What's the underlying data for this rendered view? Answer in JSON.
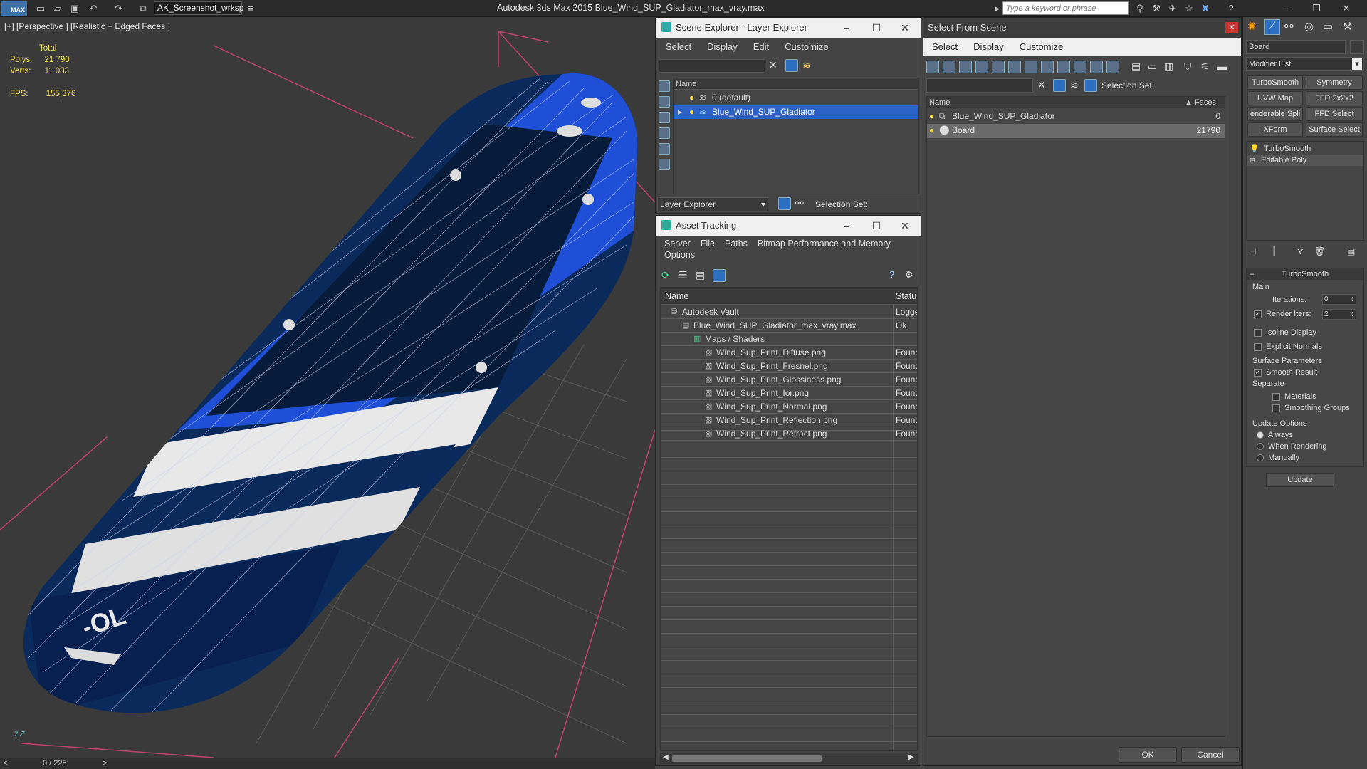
{
  "app": {
    "logo": "MAX",
    "workspace": "AK_Screenshot_wrksp",
    "title": "Autodesk 3ds Max  2015    Blue_Wind_SUP_Gladiator_max_vray.max",
    "search_placeholder": "Type a keyword or phrase"
  },
  "viewport": {
    "label": "[+] [Perspective ] [Realistic + Edged Faces ]",
    "stats": {
      "total_label": "Total",
      "polys_label": "Polys:",
      "polys_value": "21 790",
      "verts_label": "Verts:",
      "verts_value": "11 083",
      "fps_label": "FPS:",
      "fps_value": "155,376"
    },
    "timeline": "0 / 225",
    "board_colors": {
      "primary": "#1e4fd6",
      "dark": "#071c3a",
      "white": "#e8e8e8"
    }
  },
  "scene_explorer": {
    "title": "Scene Explorer - Layer Explorer",
    "menu": [
      "Select",
      "Display",
      "Edit",
      "Customize"
    ],
    "column": "Name",
    "layers": [
      {
        "label": "0 (default)"
      },
      {
        "label": "Blue_Wind_SUP_Gladiator"
      }
    ],
    "footer_dropdown": "Layer Explorer",
    "selection_set": "Selection Set:"
  },
  "asset_tracking": {
    "title": "Asset Tracking",
    "menu": [
      "Server",
      "File",
      "Paths",
      "Bitmap Performance and Memory"
    ],
    "menu2": [
      "Options"
    ],
    "columns": {
      "name": "Name",
      "status": "Status"
    },
    "rows": [
      {
        "name": "Autodesk Vault",
        "status": "Logge"
      },
      {
        "name": "Blue_Wind_SUP_Gladiator_max_vray.max",
        "status": "Ok"
      },
      {
        "name": "Maps / Shaders",
        "status": ""
      },
      {
        "name": "Wind_Sup_Print_Diffuse.png",
        "status": "Found"
      },
      {
        "name": "Wind_Sup_Print_Fresnel.png",
        "status": "Found"
      },
      {
        "name": "Wind_Sup_Print_Glossiness.png",
        "status": "Found"
      },
      {
        "name": "Wind_Sup_Print_Ior.png",
        "status": "Found"
      },
      {
        "name": "Wind_Sup_Print_Normal.png",
        "status": "Found"
      },
      {
        "name": "Wind_Sup_Print_Reflection.png",
        "status": "Found"
      },
      {
        "name": "Wind_Sup_Print_Refract.png",
        "status": "Found"
      }
    ]
  },
  "select_from_scene": {
    "title": "Select From Scene",
    "menu": [
      "Select",
      "Display",
      "Customize"
    ],
    "selection_set": "Selection Set:",
    "columns": {
      "name": "Name",
      "faces": "Faces"
    },
    "rows": [
      {
        "name": "Blue_Wind_SUP_Gladiator",
        "faces": "0"
      },
      {
        "name": "Board",
        "faces": "21790"
      }
    ],
    "ok": "OK",
    "cancel": "Cancel"
  },
  "command_panel": {
    "object_name": "Board",
    "modifier_list": "Modifier List",
    "buttons": [
      "TurboSmooth",
      "Symmetry",
      "UVW Map",
      "FFD 2x2x2",
      "enderable Spli",
      "FFD Select",
      "XForm",
      "Surface Select"
    ],
    "stack": [
      "TurboSmooth",
      "Editable Poly"
    ],
    "rollout_title": "TurboSmooth",
    "main_label": "Main",
    "iterations_label": "Iterations:",
    "iterations_value": "0",
    "render_iters_label": "Render Iters:",
    "render_iters_value": "2",
    "isoline": "Isoline Display",
    "explicit_normals": "Explicit Normals",
    "surface_params": "Surface Parameters",
    "smooth_result": "Smooth Result",
    "separate": "Separate",
    "materials": "Materials",
    "smoothing_groups": "Smoothing Groups",
    "update_options": "Update Options",
    "always": "Always",
    "when_rendering": "When Rendering",
    "manually": "Manually",
    "update_button": "Update"
  }
}
